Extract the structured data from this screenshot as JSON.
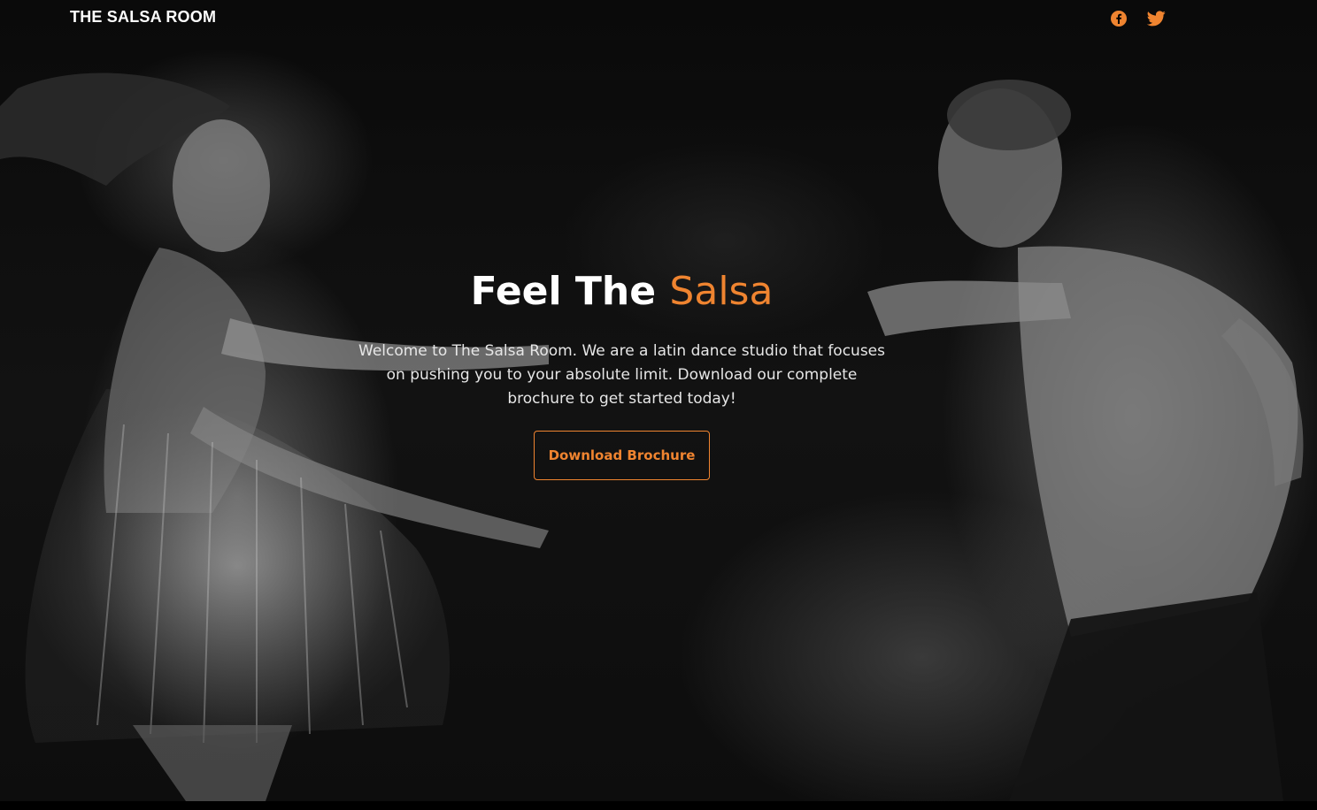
{
  "nav": {
    "brand": "THE SALSA ROOM",
    "socials": [
      {
        "icon": "facebook-icon",
        "color": "#ef8430"
      },
      {
        "icon": "twitter-icon",
        "color": "#ef8430"
      }
    ]
  },
  "hero": {
    "headline_part1": "Feel The ",
    "headline_accent": "Salsa",
    "intro": "Welcome to The Salsa Room. We are a latin dance studio that focuses on pushing you to your absolute limit. Download our complete brochure to get started today!",
    "cta_label": "Download Brochure",
    "background_image": "dancers-photo-icon"
  },
  "colors": {
    "accent": "#ef8430",
    "background": "#000000",
    "text": "#ffffff"
  }
}
